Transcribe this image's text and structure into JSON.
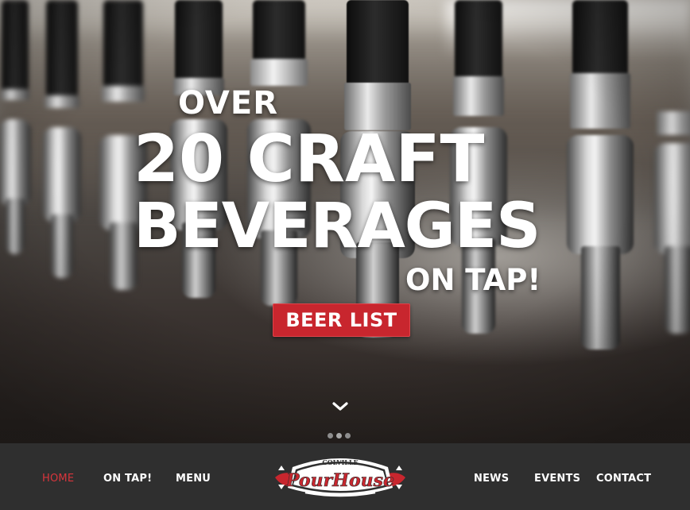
{
  "hero": {
    "headline_top": "OVER",
    "headline_line1": "20 CRAFT",
    "headline_line2": "BEVERAGES",
    "headline_bottom": "ON TAP!",
    "cta_label": "BEER LIST",
    "scroll_icon": "chevron-down-icon",
    "slider_dots": 3,
    "active_dot": 1
  },
  "nav": {
    "left_items": [
      "HOME",
      "ON TAP!",
      "MENU"
    ],
    "right_items": [
      "NEWS",
      "EVENTS",
      "CONTACT"
    ],
    "active_item": "HOME"
  },
  "logo": {
    "top_text": "COLVILLE",
    "main_text": "PourHouse"
  },
  "colors": {
    "accent_red": "#c8262e",
    "nav_bg": "#2f2f2f",
    "nav_text": "#ffffff",
    "active_nav": "#d8353c"
  }
}
